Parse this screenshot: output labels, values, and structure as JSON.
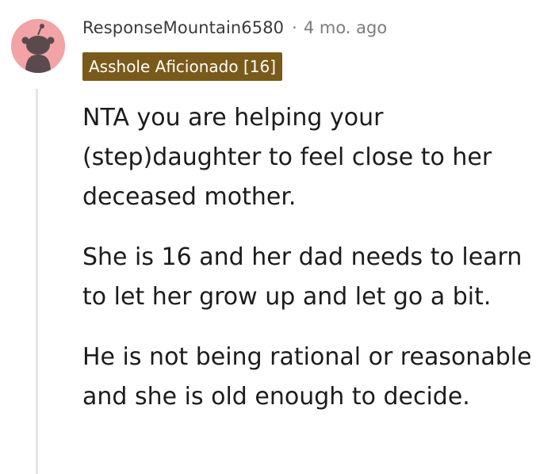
{
  "comment": {
    "username": "ResponseMountain6580",
    "separator": "·",
    "timestamp": "4 mo. ago",
    "flair": "Asshole Aficionado [16]",
    "paragraphs": [
      "NTA you are helping your (step)daughter to feel close to her deceased mother.",
      "She is 16 and her dad needs to learn to let her grow up and let go a bit.",
      "He is not being rational or reasonable and she is old enough to decide."
    ]
  },
  "icons": {
    "avatar": "reddit-snoo-avatar-icon"
  },
  "colors": {
    "avatar_bg": "#f1a3a6",
    "flair_bg": "#7a5a1a",
    "flair_text": "#ffffff",
    "thread_line": "#e4e6e8",
    "text": "#1c1c1c",
    "meta_text": "#7c7c7c"
  }
}
